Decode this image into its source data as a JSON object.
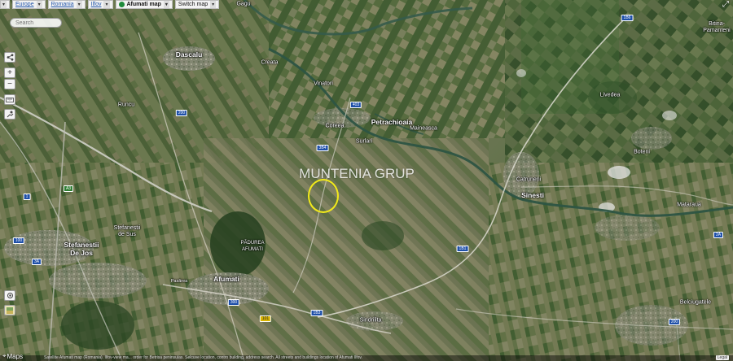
{
  "toolbar": {
    "crumbs": [
      {
        "label": "Europe"
      },
      {
        "label": "Romania"
      },
      {
        "label": "Ilfov"
      },
      {
        "label": "Afumati map"
      }
    ],
    "switch_label": "Switch map"
  },
  "search": {
    "placeholder": "Search"
  },
  "controls": {
    "zoom_in": "+",
    "zoom_out": "−"
  },
  "places": {
    "gagu": "Gagu",
    "bitina": "Bitina-\nPamanteni",
    "dascalu": "Dascalu",
    "creata": "Creata",
    "vinatori": "Vinatori",
    "runcu": "Runcu",
    "livedea": "Livedea",
    "coreea": "Coreea",
    "petrachioaia": "Petrachioaia",
    "maineasca": "Maineasca",
    "surlari": "Surlari",
    "boteni": "Boteni",
    "catruneni": "Catruneni",
    "sinesti": "Sinesti",
    "mataraua": "Mataraua",
    "stefanestii_sus": "Stefanestii\nde Sus",
    "stefanestii_jos": "Stefanestii\nDe Jos",
    "padurea": "PĂDUREA\nAFUMATI",
    "afumati": "Afumati",
    "pasarea": "Pasărea",
    "sindrilita": "Sindrilita",
    "belciugatele": "Belciugatele"
  },
  "road_shields": {
    "dn2_top": "1B6",
    "r403": "403",
    "r200": "200",
    "r3B4": "3B4",
    "a3": "A3",
    "dn2_mid": "1B1",
    "r100": "100",
    "r2a": "2A",
    "r1b3": "1B3",
    "r300": "300",
    "r3a": "3A",
    "r101": "101",
    "r1": "1",
    "r200b": "200"
  },
  "watermark": "MUNTENIA GRUP",
  "footer": {
    "maps_label": "Maps",
    "attribution": "Satellite Afumati map (Romania). Ilfov-view ma... order for Betrisa peninsulas. Selcuve location, contro building, address search. All streets and buildings location of Afumati Ilfov.",
    "legal": "Legal"
  }
}
